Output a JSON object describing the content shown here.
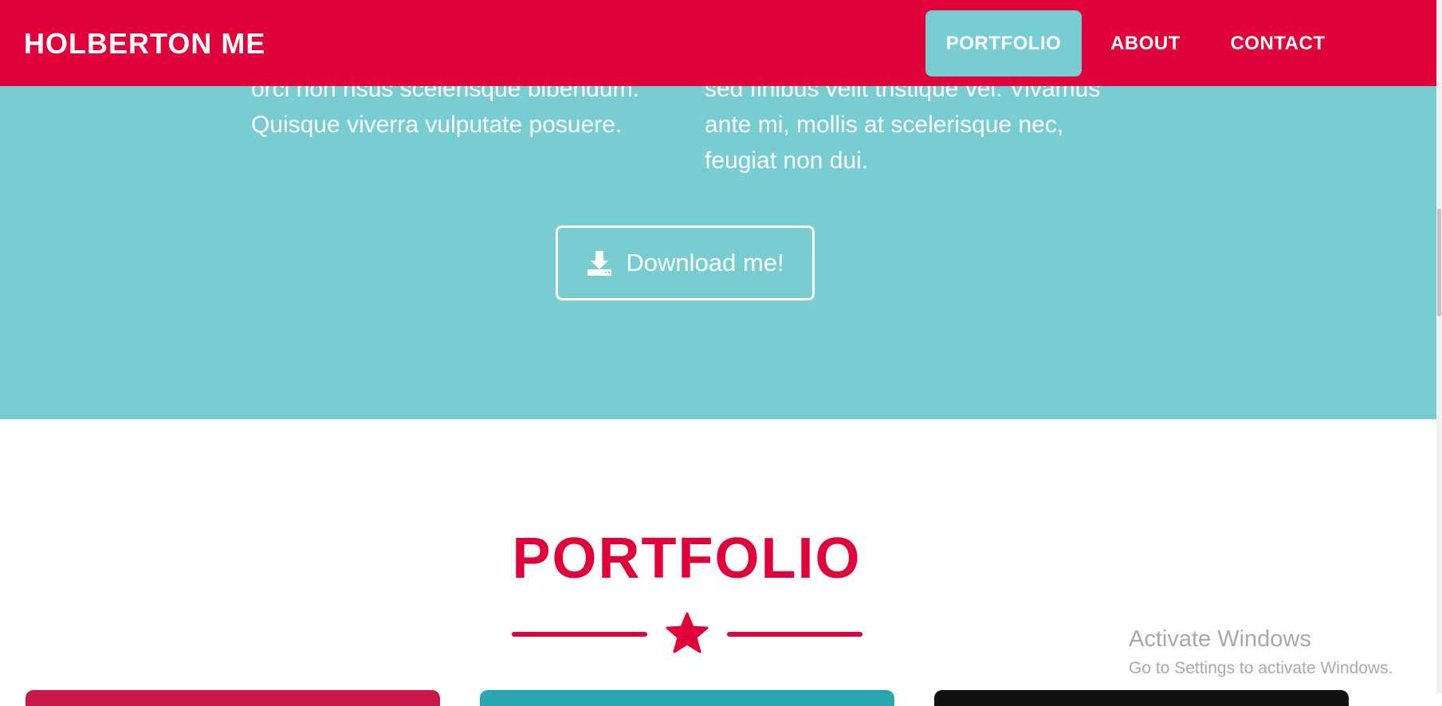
{
  "navbar": {
    "brand": "HOLBERTON ME",
    "items": [
      {
        "label": "PORTFOLIO",
        "active": true
      },
      {
        "label": "ABOUT",
        "active": false
      },
      {
        "label": "CONTACT",
        "active": false
      }
    ]
  },
  "about": {
    "left_text_line1": "orci non risus scelerisque bibendum.",
    "left_text_line2": "Quisque viverra vulputate posuere.",
    "right_text_line1": "sed finibus velit tristique vel. Vivamus",
    "right_text_line2": "ante mi, mollis at scelerisque nec,",
    "right_text_line3": "feugiat non dui.",
    "download_button_label": "Download me!",
    "download_icon": "download-icon"
  },
  "portfolio": {
    "title": "PORTFOLIO",
    "divider_icon": "star-icon"
  },
  "watermark": {
    "title": "Activate Windows",
    "subtitle": "Go to Settings to activate Windows."
  },
  "colors": {
    "primary": "#e0003a",
    "secondary": "#78cdd2",
    "white": "#ffffff"
  }
}
